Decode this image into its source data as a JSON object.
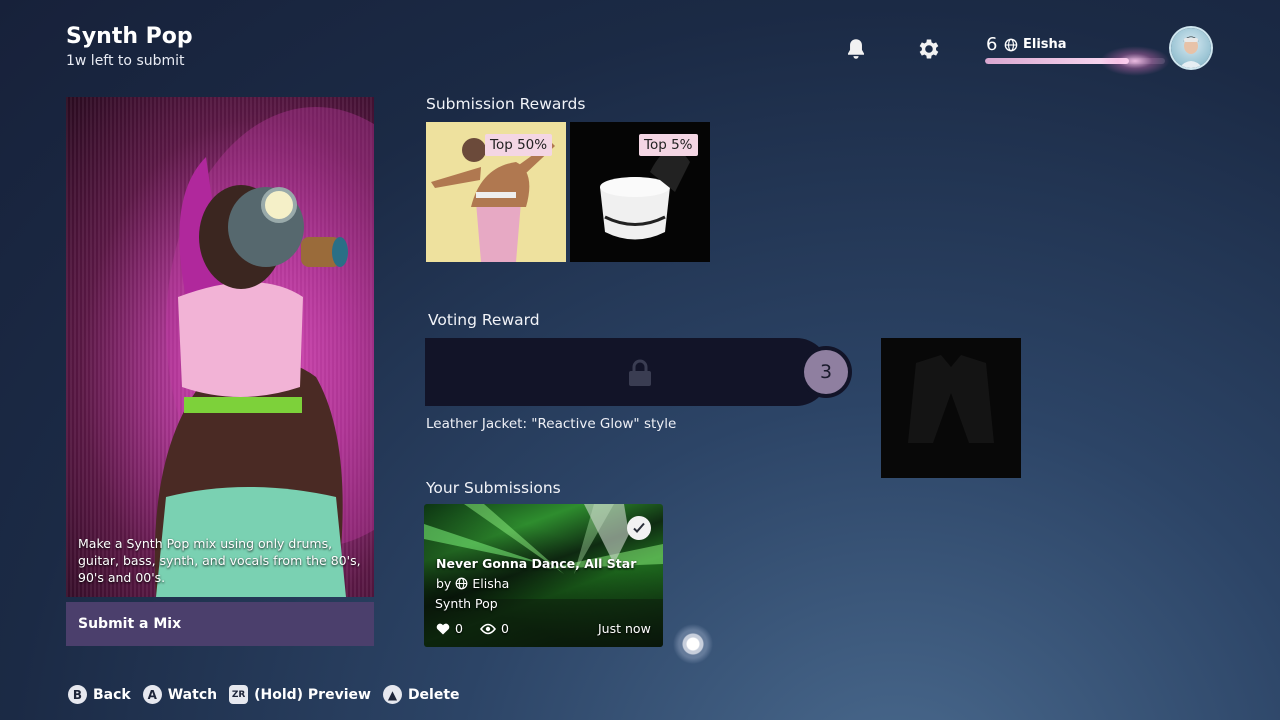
{
  "header": {
    "title": "Synth Pop",
    "subtitle": "1w left to submit",
    "level": "6",
    "username": "Elisha",
    "xp_progress": 0.8
  },
  "card": {
    "description": "Make a Synth Pop mix using only drums, guitar, bass, synth, and vocals from the 80's, 90's and 00's.",
    "submit_label": "Submit a Mix"
  },
  "submission_rewards": {
    "title": "Submission Rewards",
    "items": [
      {
        "badge": "Top 50%"
      },
      {
        "badge": "Top 5%"
      }
    ]
  },
  "voting_reward": {
    "title": "Voting Reward",
    "count": "3",
    "label": "Leather Jacket: \"Reactive Glow\" style"
  },
  "your_submissions": {
    "title": "Your Submissions",
    "item": {
      "title": "Never Gonna Dance, All Star",
      "by": "by",
      "author": "Elisha",
      "genre": "Synth Pop",
      "likes": "0",
      "views": "0",
      "time": "Just now"
    }
  },
  "footer": {
    "hints": [
      {
        "button": "B",
        "label": "Back"
      },
      {
        "button": "A",
        "label": "Watch"
      },
      {
        "button": "ZR",
        "label": "(Hold) Preview"
      },
      {
        "button": "▲",
        "label": "Delete"
      }
    ]
  }
}
